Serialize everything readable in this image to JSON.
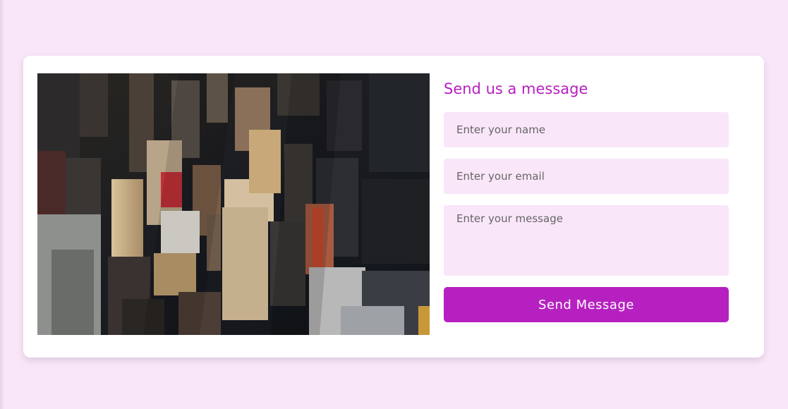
{
  "page": {
    "background_color": "#f9e6f9",
    "accent_color": "#b620c0"
  },
  "contact_form": {
    "title": "Send us a message",
    "name_placeholder": "Enter your name",
    "email_placeholder": "Enter your email",
    "message_placeholder": "Enter your message",
    "submit_label": "Send Message"
  },
  "image": {
    "subject": "aerial city skyline photo"
  }
}
